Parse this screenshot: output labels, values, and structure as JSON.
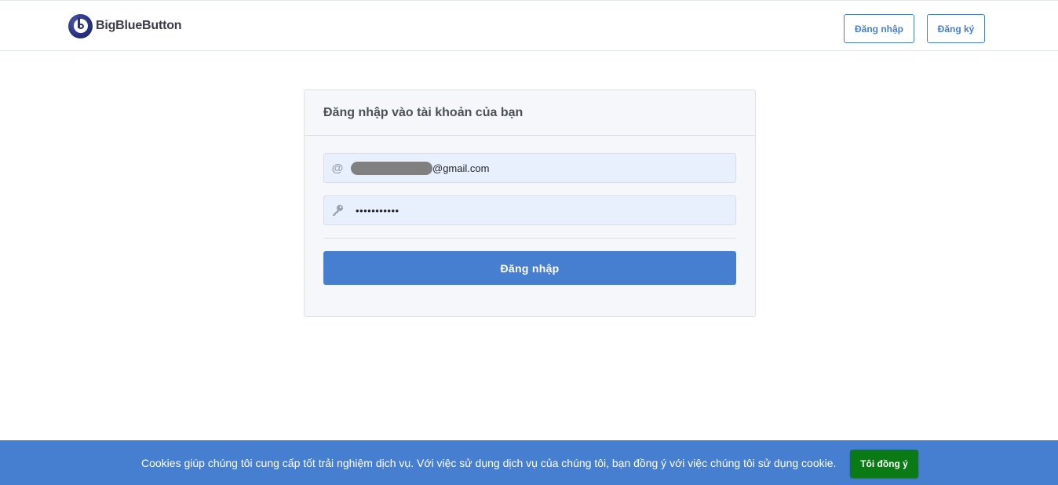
{
  "header": {
    "logo_text": "BigBlueButton",
    "login_label": "Đăng nhập",
    "signup_label": "Đăng ký"
  },
  "login_card": {
    "title": "Đăng nhập vào tài khoản của bạn",
    "email_icon": "@",
    "email_suffix": "@gmail.com",
    "password_icon": "key-icon",
    "password_mask": "•••••••••••",
    "submit_label": "Đăng nhập"
  },
  "cookie_banner": {
    "text": "Cookies giúp chúng tôi cung cấp tốt trải nghiệm dịch vụ. Với việc sử dụng dịch vụ của chúng tôi, bạn đồng ý với việc chúng tôi sử dụng cookie.",
    "accept_label": "Tôi đồng ý"
  },
  "colors": {
    "primary": "#467fcf",
    "accept": "#0a7a14",
    "input_bg": "#e8f0fe",
    "card_bg": "#f5f7fb"
  }
}
